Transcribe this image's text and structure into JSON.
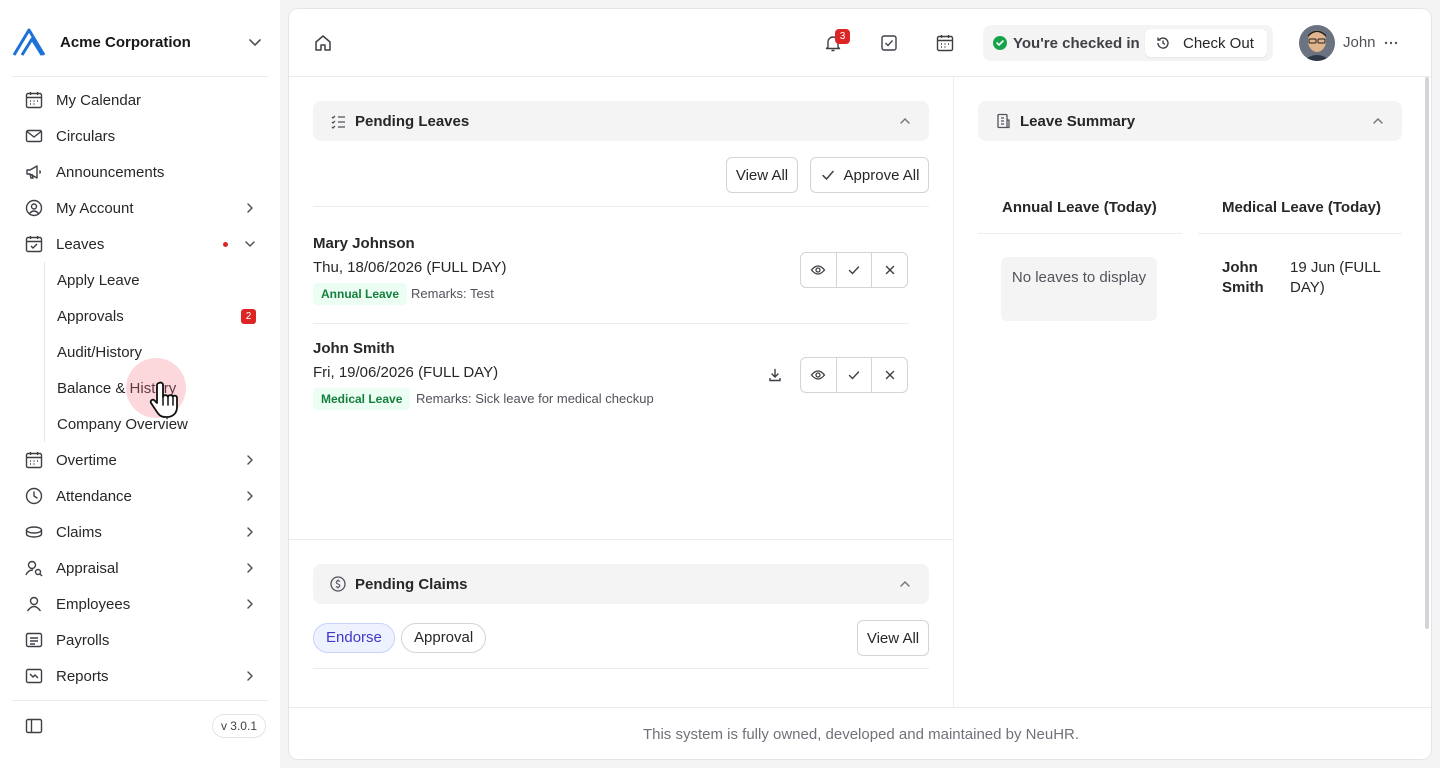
{
  "org": {
    "name": "Acme Corporation"
  },
  "colors": {
    "accent": "#2563eb",
    "danger": "#dc2626",
    "success": "#16a34a"
  },
  "sidebar": {
    "items": [
      {
        "label": "My Calendar",
        "icon": "calendar-icon"
      },
      {
        "label": "Circulars",
        "icon": "mail-icon"
      },
      {
        "label": "Announcements",
        "icon": "megaphone-icon"
      },
      {
        "label": "My Account",
        "icon": "user-circle-icon"
      },
      {
        "label": "Leaves",
        "icon": "calendar-check-icon"
      },
      {
        "label": "Overtime",
        "icon": "calendar-clock-icon"
      },
      {
        "label": "Attendance",
        "icon": "clock-icon"
      },
      {
        "label": "Claims",
        "icon": "coins-icon"
      },
      {
        "label": "Appraisal",
        "icon": "user-search-icon"
      },
      {
        "label": "Employees",
        "icon": "user-icon"
      },
      {
        "label": "Payrolls",
        "icon": "receipt-icon"
      },
      {
        "label": "Reports",
        "icon": "report-icon"
      }
    ],
    "leave_sub": [
      {
        "label": "Apply Leave"
      },
      {
        "label": "Approvals",
        "badge": "2"
      },
      {
        "label": "Audit/History"
      },
      {
        "label": "Balance & History"
      },
      {
        "label": "Company Overview"
      }
    ],
    "version": "v 3.0.1"
  },
  "topbar": {
    "notification_count": "3",
    "checkin_status": "You're checked in",
    "checkout_label": "Check Out",
    "user_name": "John"
  },
  "pending_leaves": {
    "title": "Pending Leaves",
    "view_all": "View All",
    "approve_all": "Approve All",
    "items": [
      {
        "name": "Mary Johnson",
        "date": "Thu, 18/06/2026 (FULL DAY)",
        "type": "Annual Leave",
        "remarks": "Remarks: Test"
      },
      {
        "name": "John Smith",
        "date": "Fri, 19/06/2026 (FULL DAY)",
        "type": "Medical Leave",
        "remarks": "Remarks: Sick leave for medical checkup"
      }
    ]
  },
  "pending_claims": {
    "title": "Pending Claims",
    "tabs": [
      "Endorse",
      "Approval"
    ],
    "active_tab": "Endorse",
    "view_all": "View All"
  },
  "leave_summary": {
    "title": "Leave Summary",
    "annual_header": "Annual Leave (Today)",
    "medical_header": "Medical Leave (Today)",
    "annual_empty": "No leaves to display",
    "medical_rows": [
      {
        "name": "John Smith",
        "date": "19 Jun (FULL DAY)"
      }
    ]
  },
  "footer": {
    "text": "This system is fully owned, developed and maintained by NeuHR."
  }
}
